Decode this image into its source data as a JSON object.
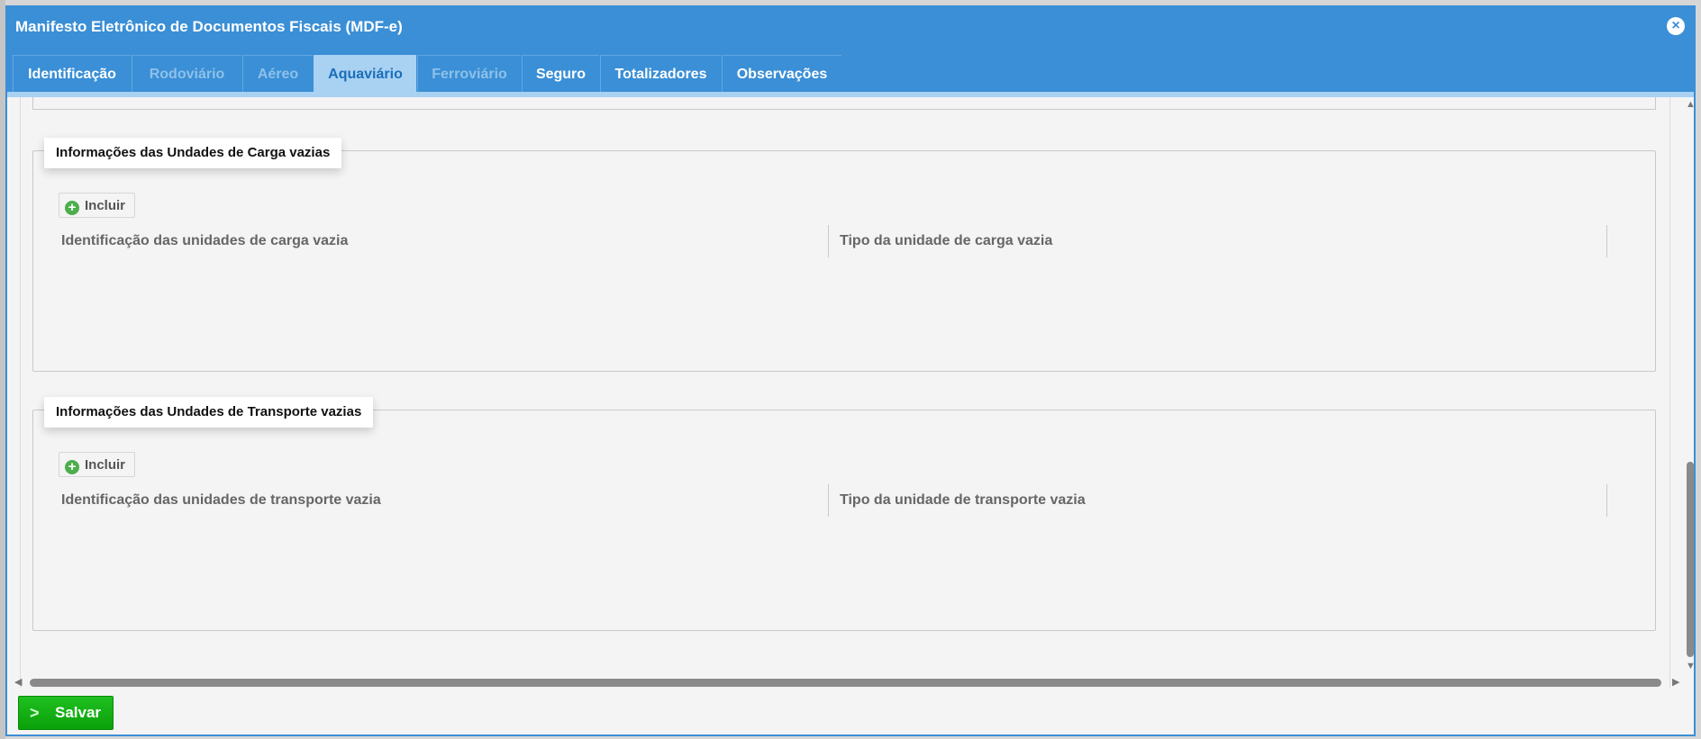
{
  "window": {
    "title": "Manifesto Eletrônico de Documentos Fiscais (MDF-e)",
    "close_icon": "close-icon",
    "accent_color": "#3a8fd6"
  },
  "tabs": [
    {
      "label": "Identificação",
      "state": "enabled"
    },
    {
      "label": "Rodoviário",
      "state": "disabled"
    },
    {
      "label": "Aéreo",
      "state": "disabled"
    },
    {
      "label": "Aquaviário",
      "state": "active"
    },
    {
      "label": "Ferroviário",
      "state": "disabled"
    },
    {
      "label": "Seguro",
      "state": "enabled"
    },
    {
      "label": "Totalizadores",
      "state": "enabled"
    },
    {
      "label": "Observações",
      "state": "enabled"
    }
  ],
  "sections": [
    {
      "legend": "Informações das Undades de Carga vazias",
      "include_label": "Incluir",
      "columns": [
        "Identificação das unidades de carga vazia",
        "Tipo da unidade de carga vazia"
      ]
    },
    {
      "legend": "Informações das Undades de Transporte vazias",
      "include_label": "Incluir",
      "columns": [
        "Identificação das unidades de transporte vazia",
        "Tipo da unidade de transporte vazia"
      ]
    }
  ],
  "footer": {
    "save_label": "Salvar",
    "save_color": "#0aa10a"
  }
}
